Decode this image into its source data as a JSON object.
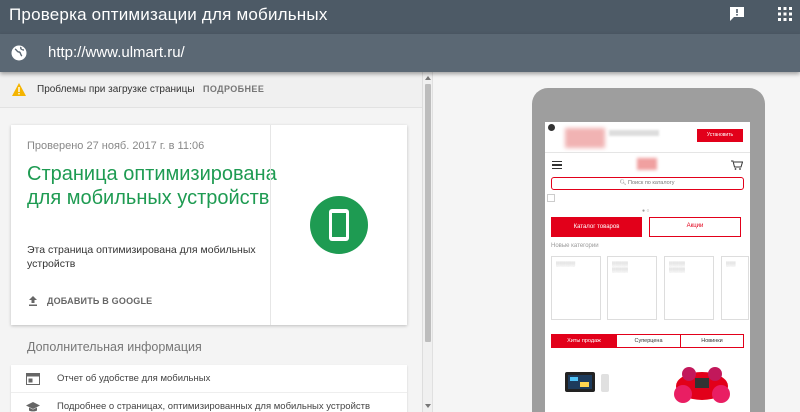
{
  "header": {
    "title": "Проверка оптимизации для мобильных",
    "url": "http://www.ulmart.ru/"
  },
  "issues": {
    "text": "Проблемы при загрузке страницы",
    "more": "ПОДРОБНЕЕ"
  },
  "result": {
    "checked": "Проверено 27 нояб. 2017 г. в 11:06",
    "headline": "Страница оптимизирована для мобильных устройств",
    "description": "Эта страница оптимизирована для мобильных устройств",
    "add_google": "ДОБАВИТЬ В GOOGLE"
  },
  "extra": {
    "title": "Дополнительная информация",
    "links": [
      {
        "label": "Отчет об удобстве для мобильных",
        "icon": "report-icon"
      },
      {
        "label": "Подробнее о страницах, оптимизированных для мобильных устройств",
        "icon": "graduation-cap-icon"
      }
    ]
  },
  "preview": {
    "install": "Установить",
    "search_placeholder": "Поиск по каталогу",
    "catalog_button": "Каталог товаров",
    "promo_button": "Акции",
    "new_categories": "Новые категории",
    "tabs": [
      "Хиты продаж",
      "Суперцена",
      "Новинки"
    ]
  },
  "colors": {
    "header_bg": "#4d5a66",
    "urlbar_bg": "#5b6874",
    "success_green": "#1e9b52",
    "brand_red": "#e2001a"
  }
}
